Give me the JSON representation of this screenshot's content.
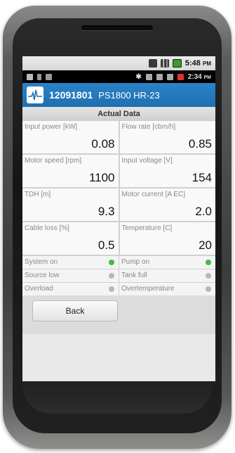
{
  "statusbar_top": {
    "time": "5:48",
    "ampm": "PM"
  },
  "statusbar_bottom": {
    "time": "2:34",
    "ampm": "PM"
  },
  "app": {
    "id": "12091801",
    "model": "PS1800 HR-23"
  },
  "section_title": "Actual Data",
  "cells": [
    {
      "label": "Input power [kW]",
      "value": "0.08"
    },
    {
      "label": "Flow rate [cbm/h]",
      "value": "0.85"
    },
    {
      "label": "Motor speed [rpm]",
      "value": "1100"
    },
    {
      "label": "Input voltage [V]",
      "value": "154"
    },
    {
      "label": "TDH [m]",
      "value": "9.3"
    },
    {
      "label": "Motor current [A EC]",
      "value": "2.0"
    },
    {
      "label": "Cable loss [%]",
      "value": "0.5"
    },
    {
      "label": "Temperature [C]",
      "value": "20"
    }
  ],
  "status": [
    {
      "label": "System on",
      "on": true
    },
    {
      "label": "Pump on",
      "on": true
    },
    {
      "label": "Source low",
      "on": false
    },
    {
      "label": "Tank full",
      "on": false
    },
    {
      "label": "Overload",
      "on": false
    },
    {
      "label": "Overtemperature",
      "on": false
    }
  ],
  "colors": {
    "led_on": "#3fbf3f",
    "led_off": "#b8b8b8",
    "appbar": "#2b83c9"
  },
  "back_label": "Back"
}
